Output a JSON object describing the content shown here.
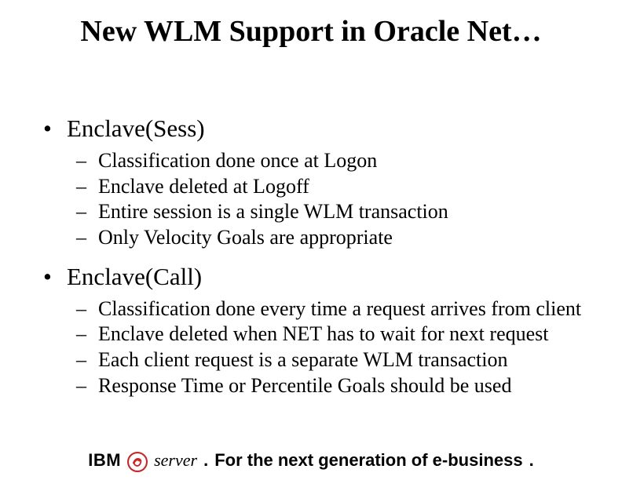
{
  "title": "New WLM Support in Oracle Net…",
  "sections": [
    {
      "heading": "Enclave(Sess)",
      "items": [
        "Classification done once at Logon",
        "Enclave deleted at Logoff",
        "Entire session is a single WLM transaction",
        "Only Velocity Goals are appropriate"
      ]
    },
    {
      "heading": "Enclave(Call)",
      "items": [
        "Classification done every time a request arrives from client",
        "Enclave deleted when NET has to wait for next request",
        "Each client request  is a separate WLM transaction",
        "Response Time or Percentile Goals should be used"
      ]
    }
  ],
  "footer": {
    "brand": "IBM",
    "server_label": "server",
    "tagline": "For the next generation of e-business",
    "dot": "."
  }
}
